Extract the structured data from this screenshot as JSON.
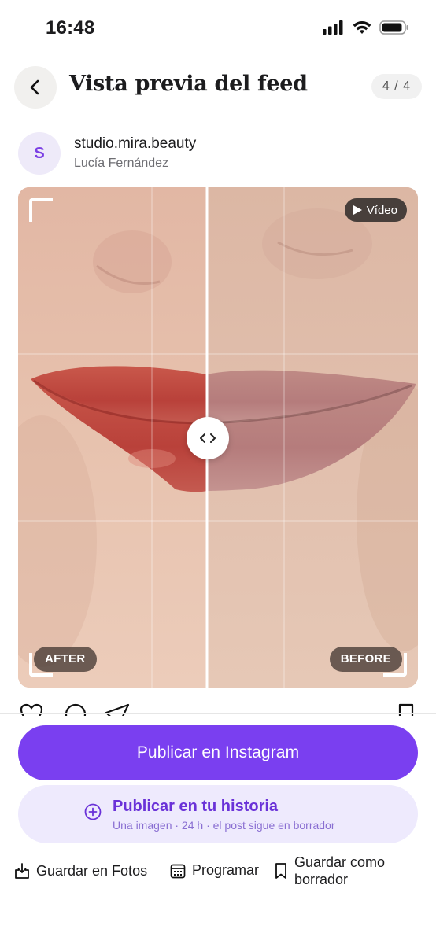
{
  "status_bar": {
    "time": "16:48"
  },
  "header": {
    "title": "Vista previa del feed",
    "counter": "4 / 4"
  },
  "account": {
    "avatar_letter": "S",
    "handle": "studio.mira.beauty",
    "name": "Lucía Fernández"
  },
  "media": {
    "video_badge": "Vídeo",
    "after_label": "AFTER",
    "before_label": "BEFORE"
  },
  "actions": {
    "primary": "Publicar en Instagram",
    "story_title": "Publicar en tu historia",
    "story_sub": "Una imagen · 24 h · el post sigue en borrador",
    "save_photos": "Guardar en Fotos",
    "schedule": "Programar",
    "save_draft_line1": "Guardar como",
    "save_draft_line2": "borrador"
  },
  "colors": {
    "accent": "#7a3ff0",
    "accent_soft": "#eeeafd"
  },
  "icons": [
    "back-chevron-icon",
    "play-icon",
    "compare-arrows-icon",
    "heart-icon",
    "comment-icon",
    "share-icon",
    "bookmark-icon",
    "plus-circle-icon",
    "download-icon",
    "calendar-icon",
    "bookmark-outline-icon"
  ]
}
